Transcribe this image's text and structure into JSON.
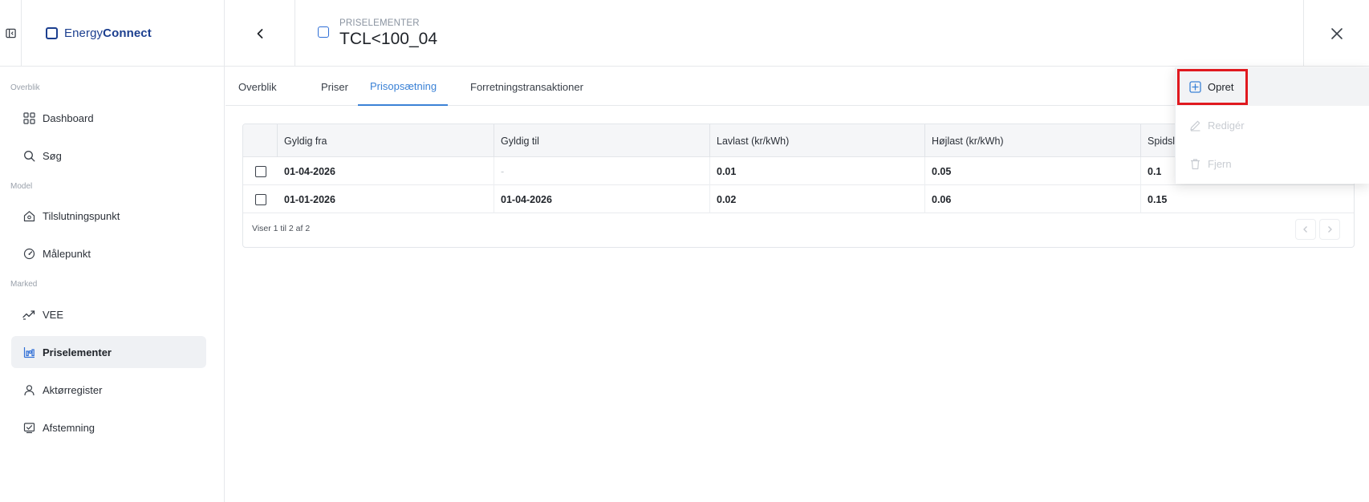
{
  "app": {
    "brand_prefix": "Energy",
    "brand_suffix": "Connect"
  },
  "header": {
    "eyebrow": "PRISELEMENTER",
    "title": "TCL<100_04"
  },
  "sidebar": {
    "sections": [
      "Overblik",
      "Model",
      "Marked"
    ],
    "items": [
      {
        "label": "Dashboard",
        "icon": "grid-icon"
      },
      {
        "label": "Søg",
        "icon": "search-icon"
      },
      {
        "label": "Tilslutningspunkt",
        "icon": "house-icon"
      },
      {
        "label": "Målepunkt",
        "icon": "gauge-icon"
      },
      {
        "label": "VEE",
        "icon": "trend-icon"
      },
      {
        "label": "Priselementer",
        "icon": "price-chart-icon",
        "active": true
      },
      {
        "label": "Aktørregister",
        "icon": "user-icon"
      },
      {
        "label": "Afstemning",
        "icon": "chart-check-icon"
      }
    ]
  },
  "tabs": [
    {
      "label": "Overblik"
    },
    {
      "label": "Priser"
    },
    {
      "label": "Prisopsætning",
      "active": true
    },
    {
      "label": "Forretningstransaktioner"
    }
  ],
  "table": {
    "columns": [
      "Gyldig fra",
      "Gyldig til",
      "Lavlast (kr/kWh)",
      "Højlast (kr/kWh)",
      "Spidsla"
    ],
    "rows": [
      [
        "01-04-2026",
        "-",
        "0.01",
        "0.05",
        "0.1"
      ],
      [
        "01-01-2026",
        "01-04-2026",
        "0.02",
        "0.06",
        "0.15"
      ]
    ],
    "footer": "Viser 1 til 2 af 2"
  },
  "menu": {
    "items": [
      {
        "label": "Opret",
        "icon": "plus-square-icon",
        "enabled": true
      },
      {
        "label": "Redigér",
        "icon": "pencil-icon",
        "enabled": false
      },
      {
        "label": "Fjern",
        "icon": "trash-icon",
        "enabled": false
      }
    ]
  },
  "colors": {
    "accent": "#3b82d6",
    "brand": "#1c3f8f",
    "highlight": "#e0191f"
  }
}
